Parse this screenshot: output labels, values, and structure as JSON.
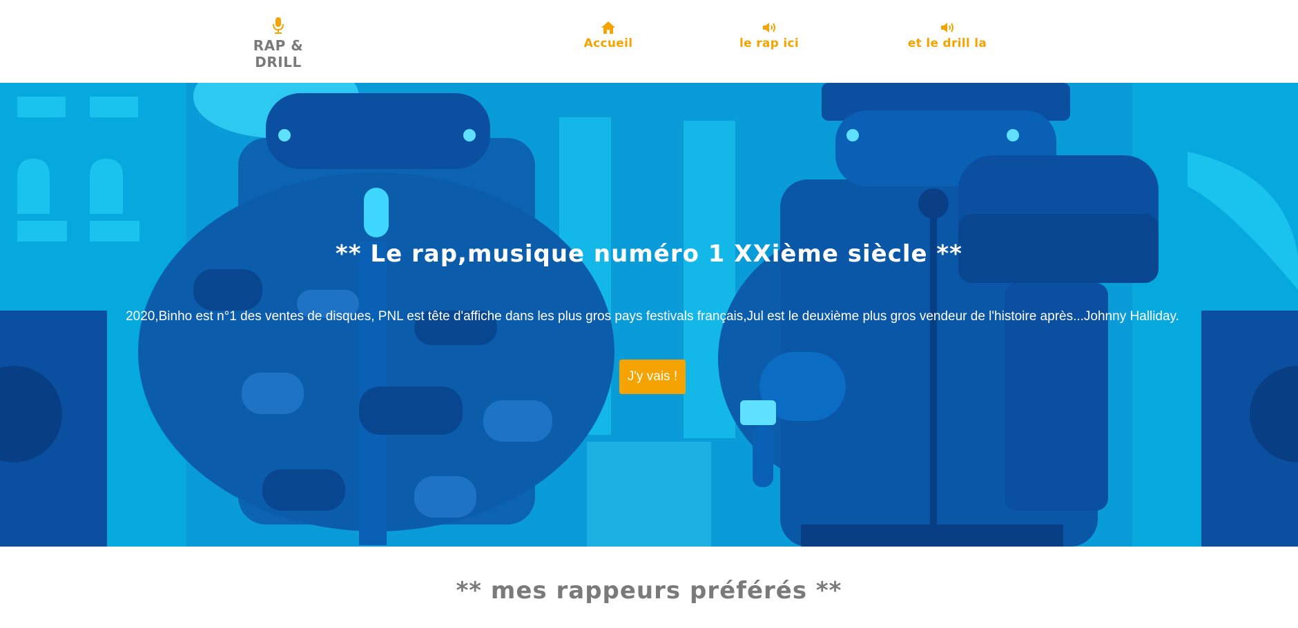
{
  "header": {
    "brand": {
      "icon": "microphone-icon",
      "label": "RAP & DRILL"
    },
    "nav": [
      {
        "icon": "home-icon",
        "label": "Accueil"
      },
      {
        "icon": "speaker-icon",
        "label": "le rap ici"
      },
      {
        "icon": "speaker-icon",
        "label": "et le drill la"
      }
    ]
  },
  "hero": {
    "title": "** Le rap,musique numéro 1 XXième siècle **",
    "text": "2020,Binho est n°1 des ventes de disques, PNL est tête d'affiche dans les plus gros pays festivals français,Jul est le deuxième plus gros vendeur de l'histoire après...Johnny Halliday.",
    "button_label": "J'y vais !"
  },
  "section": {
    "title": "** mes rappeurs préférés **"
  },
  "colors": {
    "accent": "#f5a300",
    "grey_text": "#7a7a7a",
    "hero_blue": "#0a9bd9"
  }
}
